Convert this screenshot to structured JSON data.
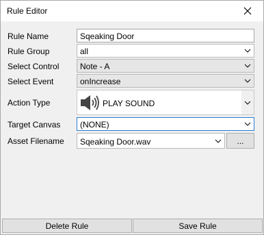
{
  "window": {
    "title": "Rule Editor"
  },
  "form": {
    "rule_name": {
      "label": "Rule Name",
      "value": "Sqeaking Door"
    },
    "rule_group": {
      "label": "Rule Group",
      "value": "all"
    },
    "select_control": {
      "label": "Select Control",
      "value": "Note - A"
    },
    "select_event": {
      "label": "Select Event",
      "value": "onIncrease"
    },
    "action_type": {
      "label": "Action Type",
      "value": "PLAY SOUND",
      "icon": "speaker-icon"
    },
    "target_canvas": {
      "label": "Target Canvas",
      "value": "(NONE)"
    },
    "asset_filename": {
      "label": "Asset Filename",
      "value": "Sqeaking Door.wav",
      "browse_label": "..."
    }
  },
  "buttons": {
    "delete_label": "Delete Rule",
    "save_label": "Save Rule"
  },
  "colors": {
    "focus_border": "#2b7ad6",
    "window_bg": "#f0f0f0"
  }
}
